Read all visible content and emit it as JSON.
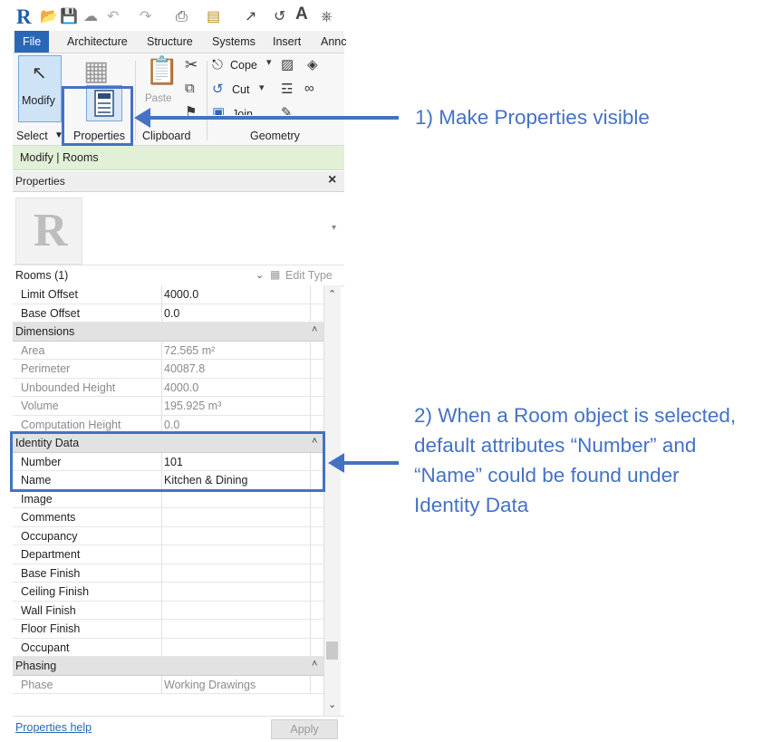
{
  "ribbon": {
    "tabs": [
      "File",
      "Architecture",
      "Structure",
      "Systems",
      "Insert",
      "Annc"
    ],
    "modify_label": "Modify",
    "paste_label": "Paste",
    "cope_label": "Cope",
    "cut_label": "Cut",
    "join_label": "Join",
    "panels": {
      "select": "Select",
      "properties": "Properties",
      "clipboard": "Clipboard",
      "geometry": "Geometry"
    }
  },
  "context_bar": "Modify | Rooms",
  "palette": {
    "title": "Properties",
    "close": "×",
    "type_selector": "Rooms (1)",
    "edit_type": "Edit Type",
    "help_link": "Properties help",
    "apply_label": "Apply"
  },
  "rows": [
    {
      "kind": "param",
      "key": "Limit Offset",
      "value": "4000.0"
    },
    {
      "kind": "param",
      "key": "Base Offset",
      "value": "0.0"
    },
    {
      "kind": "group",
      "key": "Dimensions"
    },
    {
      "kind": "readonly",
      "key": "Area",
      "value": "72.565 m²"
    },
    {
      "kind": "readonly",
      "key": "Perimeter",
      "value": "40087.8"
    },
    {
      "kind": "readonly",
      "key": "Unbounded Height",
      "value": "4000.0"
    },
    {
      "kind": "readonly",
      "key": "Volume",
      "value": "195.925 m³"
    },
    {
      "kind": "readonly",
      "key": "Computation Height",
      "value": "0.0"
    },
    {
      "kind": "group",
      "key": "Identity Data"
    },
    {
      "kind": "param",
      "key": "Number",
      "value": "101"
    },
    {
      "kind": "param",
      "key": "Name",
      "value": "Kitchen & Dining"
    },
    {
      "kind": "param",
      "key": "Image",
      "value": ""
    },
    {
      "kind": "param",
      "key": "Comments",
      "value": ""
    },
    {
      "kind": "param",
      "key": "Occupancy",
      "value": ""
    },
    {
      "kind": "param",
      "key": "Department",
      "value": ""
    },
    {
      "kind": "param",
      "key": "Base Finish",
      "value": ""
    },
    {
      "kind": "param",
      "key": "Ceiling Finish",
      "value": ""
    },
    {
      "kind": "param",
      "key": "Wall Finish",
      "value": ""
    },
    {
      "kind": "param",
      "key": "Floor Finish",
      "value": ""
    },
    {
      "kind": "param",
      "key": "Occupant",
      "value": ""
    },
    {
      "kind": "group",
      "key": "Phasing"
    },
    {
      "kind": "readonly",
      "key": "Phase",
      "value": "Working Drawings"
    }
  ],
  "annotations": {
    "step1": "1) Make Properties visible",
    "step2_lines": [
      "2) When a Room object is selected,",
      "default attributes “Number” and",
      "“Name” could be found under",
      "Identity Data"
    ]
  },
  "colors": {
    "annotation": "#4472c4",
    "file_tab": "#2a68b6",
    "context_bar": "#e1f0d6"
  },
  "icons": [
    "revit-logo-icon",
    "open-icon",
    "save-icon",
    "undo-icon",
    "redo-icon",
    "print-icon",
    "text-icon",
    "cursor-arrow-icon",
    "properties-icon",
    "scissors-icon",
    "chevron-down-icon",
    "collapse-icon",
    "scroll-up-icon",
    "scroll-down-icon"
  ]
}
